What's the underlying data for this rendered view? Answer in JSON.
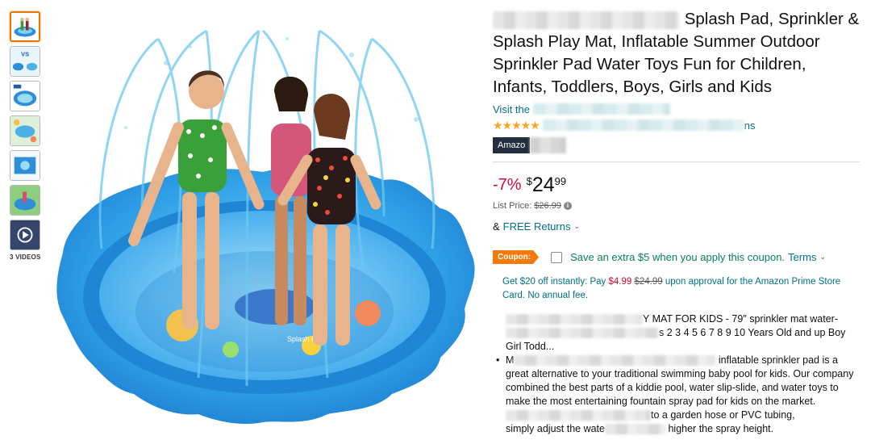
{
  "gallery": {
    "thumbnails": [
      "thumb-1",
      "thumb-2",
      "thumb-3",
      "thumb-4",
      "thumb-5",
      "thumb-6",
      "thumb-video"
    ],
    "thumb2_text": "VS",
    "videos_label": "3 VIDEOS",
    "main_image_text": "Splash Pad"
  },
  "product": {
    "title_visible": "Splash Pad, Sprinkler & Splash Play Mat, Inflatable Summer Outdoor Sprinkler Pad Water Toys Fun for Children, Infants, Toddlers, Boys, Girls and Kids",
    "store_link_prefix": "Visit the",
    "ratings_suffix": "ns",
    "badge_prefix": "Amazo",
    "stars": "★★★★★",
    "discount": "-7%",
    "price_symbol": "$",
    "price_whole": "24",
    "price_fraction": "99",
    "list_price_label": "List Price:",
    "list_price": "$26.99",
    "returns_prefix": "&",
    "returns_link": "FREE Returns",
    "coupon_label": "Coupon:",
    "coupon_text": "Save an extra $5 when you apply this coupon.",
    "coupon_terms": "Terms",
    "card_offer_pre": "Get $20 off instantly: Pay ",
    "card_offer_price": "$4.99",
    "card_offer_old": "$24.99",
    "card_offer_post": " upon approval for the Amazon Prime Store Card. No annual fee."
  },
  "bullets": {
    "b1_line1_tail": "Y MAT FOR KIDS - 79\" sprinkler mat water-",
    "b1_line2_tail": "s 2 3 4 5 6 7 8 9 10 Years Old and up Boy",
    "b1_line3": "Girl Todd...",
    "b2_line1_head": "M",
    "b2_line1_tail": "inflatable sprinkler pad is a",
    "b2_rest": "great alternative to your traditional swimming baby pool for kids. Our company combined the best parts of a kiddie pool, water slip-slide, and water toys to make the most entertaining fountain spray pad for kids on the market.",
    "b2_line5_tail": "to a garden hose or PVC tubing,",
    "b2_line6_head": "simply adjust the wate",
    "b2_line6_tail": "higher the spray height."
  },
  "colors": {
    "accent_orange": "#F57A0B",
    "link_teal": "#007185",
    "price_red": "#CC0C39",
    "coupon_green": "#067D62",
    "star": "#FFA41C",
    "badge_dark": "#232F3E"
  }
}
